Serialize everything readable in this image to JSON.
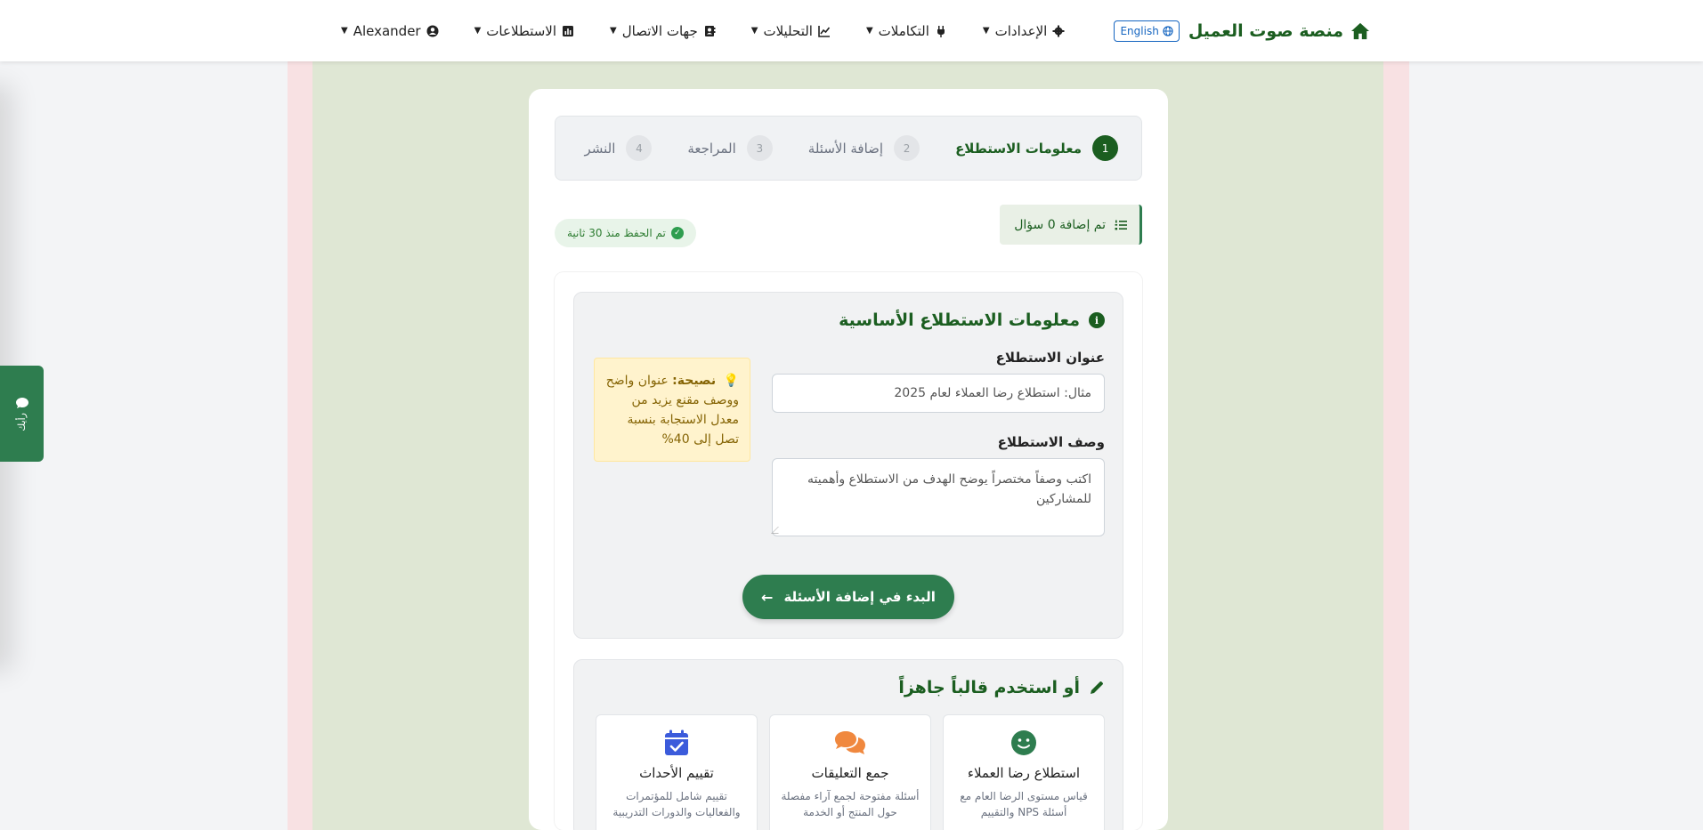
{
  "navbar": {
    "brand": "منصة صوت العميل",
    "language": "English",
    "menu": [
      {
        "label": "الإعدادات",
        "icon": "gear-icon"
      },
      {
        "label": "التكاملات",
        "icon": "plug-icon"
      },
      {
        "label": "التحليلات",
        "icon": "chart-line-icon"
      },
      {
        "label": "جهات الاتصال",
        "icon": "address-book-icon"
      },
      {
        "label": "الاستطلاعات",
        "icon": "poll-icon"
      }
    ],
    "user": "Alexander"
  },
  "feedback_tab": {
    "label": "رأيك"
  },
  "stepper": {
    "steps": [
      {
        "num": "1",
        "label": "معلومات الاستطلاع"
      },
      {
        "num": "2",
        "label": "إضافة الأسئلة"
      },
      {
        "num": "3",
        "label": "المراجعة"
      },
      {
        "num": "4",
        "label": "النشر"
      }
    ]
  },
  "status": {
    "questions_added": "تم إضافة 0 سؤال",
    "saved": "تم الحفظ منذ 30 ثانية"
  },
  "basic_info": {
    "title": "معلومات الاستطلاع الأساسية",
    "title_label": "عنوان الاستطلاع",
    "title_placeholder": "مثال: استطلاع رضا العملاء لعام 2025",
    "desc_label": "وصف الاستطلاع",
    "desc_placeholder": "اكتب وصفاً مختصراً يوضح الهدف من الاستطلاع وأهميته للمشاركين",
    "tip_strong": "نصيحة:",
    "tip_text": "عنوان واضح ووصف مقنع يزيد من معدل الاستجابة بنسبة تصل إلى 40%",
    "start_button": "البدء في إضافة الأسئلة"
  },
  "templates": {
    "title": "أو استخدم قالباً جاهزاً",
    "items": [
      {
        "name": "استطلاع رضا العملاء",
        "desc": "قياس مستوى الرضا العام مع أسئلة NPS والتقييم",
        "icon": "smile-icon",
        "color": "#2e7d4f"
      },
      {
        "name": "جمع التعليقات",
        "desc": "أسئلة مفتوحة لجمع آراء مفصلة حول المنتج أو الخدمة",
        "icon": "comments-icon",
        "color": "#f0883e"
      },
      {
        "name": "تقييم الأحداث",
        "desc": "تقييم شامل للمؤتمرات والفعاليات والدورات التدريبية",
        "icon": "calendar-check-icon",
        "color": "#3b5bdb"
      }
    ]
  },
  "colors": {
    "brand_green": "#1b5e20",
    "button_green": "#2e7d4f",
    "link_blue": "#1565c0"
  }
}
